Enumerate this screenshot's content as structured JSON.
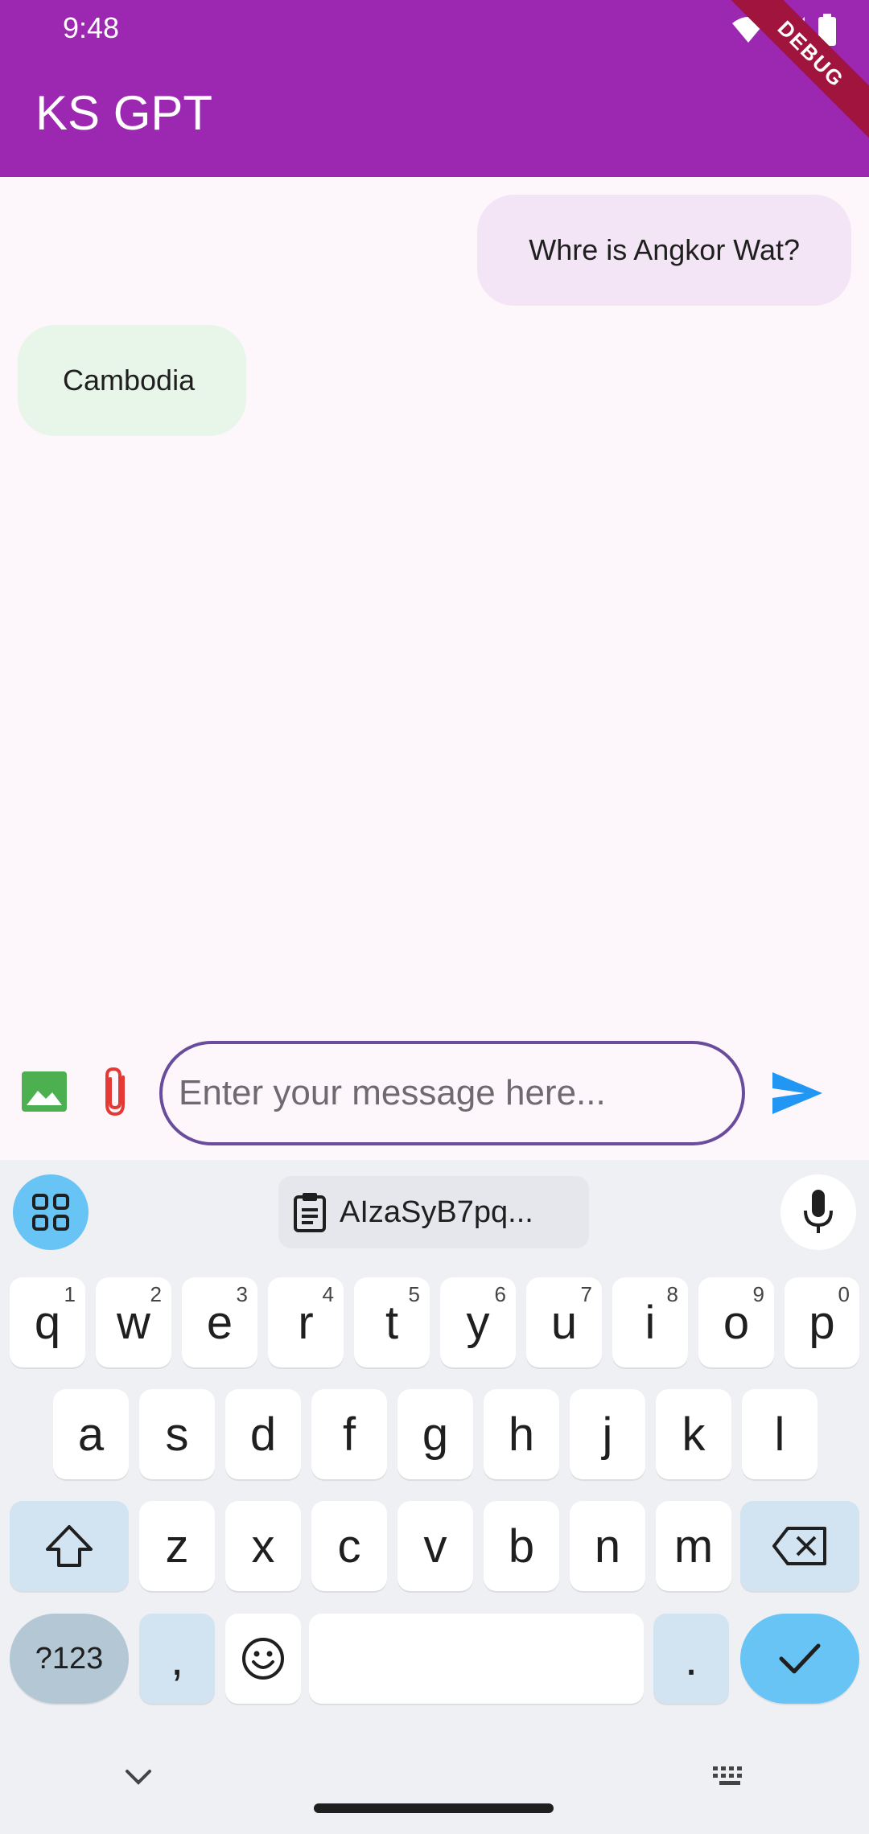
{
  "status_bar": {
    "time": "9:48",
    "icons": [
      "wifi-icon",
      "signal-icon",
      "battery-icon"
    ]
  },
  "app_bar": {
    "title": "KS GPT",
    "color": "#9c27b0",
    "debug_banner": "DEBUG"
  },
  "messages": [
    {
      "role": "user",
      "text": "Whre is Angkor Wat?",
      "color": "#f3e5f5"
    },
    {
      "role": "bot",
      "text": "Cambodia",
      "color": "#e8f5e9"
    }
  ],
  "composer": {
    "placeholder": "Enter your message here...",
    "value": "",
    "image_icon": "image-icon",
    "attach_icon": "paperclip-icon",
    "send_icon": "send-icon"
  },
  "keyboard": {
    "clipboard_suggestion": "AIzaSyB7pq...",
    "row1": [
      {
        "k": "q",
        "h": "1"
      },
      {
        "k": "w",
        "h": "2"
      },
      {
        "k": "e",
        "h": "3"
      },
      {
        "k": "r",
        "h": "4"
      },
      {
        "k": "t",
        "h": "5"
      },
      {
        "k": "y",
        "h": "6"
      },
      {
        "k": "u",
        "h": "7"
      },
      {
        "k": "i",
        "h": "8"
      },
      {
        "k": "o",
        "h": "9"
      },
      {
        "k": "p",
        "h": "0"
      }
    ],
    "row2": [
      "a",
      "s",
      "d",
      "f",
      "g",
      "h",
      "j",
      "k",
      "l"
    ],
    "row3": [
      "z",
      "x",
      "c",
      "v",
      "b",
      "n",
      "m"
    ],
    "symbols_label": "?123",
    "comma_label": ",",
    "period_label": "."
  }
}
